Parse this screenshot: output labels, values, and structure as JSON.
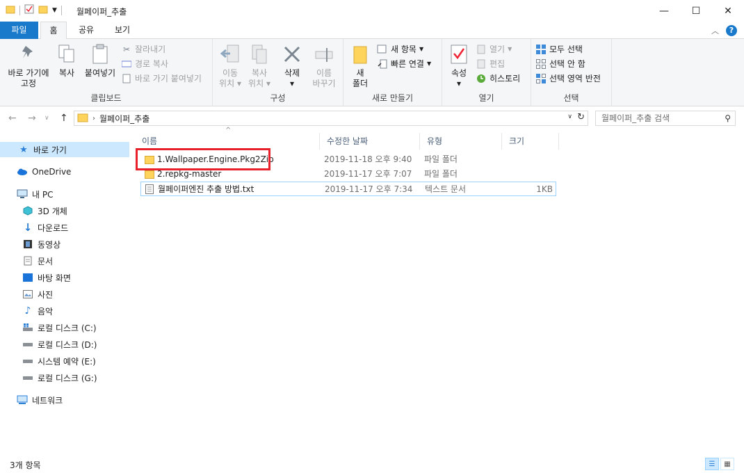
{
  "window": {
    "title": "월페이퍼_추출",
    "controls": {
      "minimize": "—",
      "maximize": "☐",
      "close": "✕"
    }
  },
  "ribbon_tabs": [
    "파일",
    "홈",
    "공유",
    "보기"
  ],
  "ribbon": {
    "clipboard": {
      "label": "클립보드",
      "pin": [
        "바로 가기에",
        "고정"
      ],
      "copy": "복사",
      "paste": "붙여넣기",
      "cut": "잘라내기",
      "copy_path": "경로 복사",
      "paste_shortcut": "바로 가기 붙여넣기"
    },
    "organize": {
      "label": "구성",
      "move": [
        "이동",
        "위치"
      ],
      "copy_to": [
        "복사",
        "위치"
      ],
      "delete": "삭제",
      "rename": [
        "이름",
        "바꾸기"
      ]
    },
    "new": {
      "label": "새로 만들기",
      "new_folder": [
        "새",
        "폴더"
      ],
      "new_item": "새 항목",
      "easy_access": "빠른 연결"
    },
    "open": {
      "label": "열기",
      "properties": "속성",
      "open": "열기",
      "edit": "편집",
      "history": "히스토리"
    },
    "select": {
      "label": "선택",
      "select_all": "모두 선택",
      "select_none": "선택 안 함",
      "invert": "선택 영역 반전"
    }
  },
  "address": {
    "path": "월페이퍼_추출",
    "search_placeholder": "월페이퍼_추출 검색"
  },
  "sidebar": [
    {
      "label": "바로 가기",
      "icon": "star-icon",
      "selected": true
    },
    {
      "label": "OneDrive",
      "icon": "cloud-icon"
    },
    {
      "label": "내 PC",
      "icon": "monitor-icon"
    },
    {
      "label": "3D 개체",
      "icon": "cube-icon"
    },
    {
      "label": "다운로드",
      "icon": "download-icon"
    },
    {
      "label": "동영상",
      "icon": "film-icon"
    },
    {
      "label": "문서",
      "icon": "document-icon"
    },
    {
      "label": "바탕 화면",
      "icon": "desktop-icon"
    },
    {
      "label": "사진",
      "icon": "picture-icon"
    },
    {
      "label": "음악",
      "icon": "music-icon"
    },
    {
      "label": "로컬 디스크 (C:)",
      "icon": "windows-drive-icon"
    },
    {
      "label": "로컬 디스크 (D:)",
      "icon": "drive-icon"
    },
    {
      "label": "시스템 예약 (E:)",
      "icon": "drive-icon"
    },
    {
      "label": "로컬 디스크 (G:)",
      "icon": "drive-icon"
    },
    {
      "label": "네트워크",
      "icon": "network-icon"
    }
  ],
  "columns": [
    "이름",
    "수정한 날짜",
    "유형",
    "크기"
  ],
  "files": [
    {
      "name": "1.Wallpaper.Engine.Pkg2Zip",
      "date": "2019-11-18 오후 9:40",
      "type": "파일 폴더",
      "size": "",
      "icon": "folder-icon"
    },
    {
      "name": "2.repkg-master",
      "date": "2019-11-17 오후 7:07",
      "type": "파일 폴더",
      "size": "",
      "icon": "folder-icon"
    },
    {
      "name": "월페이퍼엔진 추출 방법.txt",
      "date": "2019-11-17 오후 7:34",
      "type": "텍스트 문서",
      "size": "1KB",
      "icon": "text-file-icon"
    }
  ],
  "status": "3개 항목",
  "colors": {
    "accent": "#1979ca",
    "selected": "#cce8ff",
    "highlight": "#e8202a",
    "folder": "#ffd45c"
  }
}
